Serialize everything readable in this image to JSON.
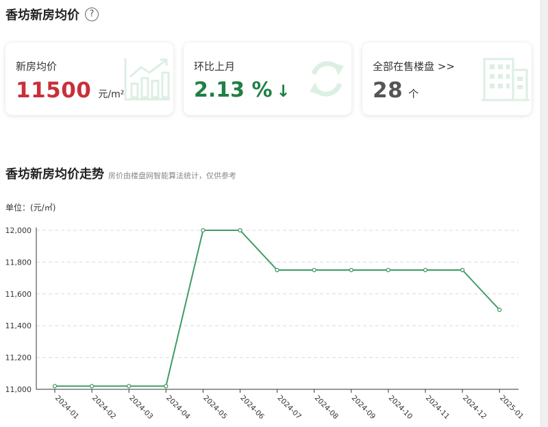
{
  "header": {
    "title": "香坊新房均价",
    "help_icon": "question-circle-icon"
  },
  "cards": {
    "price": {
      "label": "新房均价",
      "value": "11500",
      "unit": "元/m²",
      "value_color": "#c8303a",
      "icon": "trend-bars-icon"
    },
    "mom": {
      "label": "环比上月",
      "value": "2.13 %",
      "arrow": "↓",
      "value_color": "#1f7f45",
      "icon": "refresh-cycle-icon"
    },
    "listings": {
      "label": "全部在售楼盘 >>",
      "value": "28",
      "unit": "个",
      "value_color": "#555555",
      "icon": "building-icon"
    }
  },
  "section": {
    "title": "香坊新房均价走势",
    "note": "房价由楼盘网智能算法统计，仅供参考",
    "unit_label": "单位：(元/㎡)"
  },
  "colors": {
    "line": "#3f9a62",
    "grid": "#d9d9d9",
    "accent_red": "#c8303a",
    "accent_green": "#1f7f45",
    "deco_green": "#dcefe3"
  },
  "chart_data": {
    "type": "line",
    "categories": [
      "2024-01",
      "2024-02",
      "2024-03",
      "2024-04",
      "2024-05",
      "2024-06",
      "2024-07",
      "2024-08",
      "2024-09",
      "2024-10",
      "2024-11",
      "2024-12",
      "2025-01"
    ],
    "series": [
      {
        "values": [
          11020,
          11020,
          11020,
          11020,
          12000,
          12000,
          11750,
          11750,
          11750,
          11750,
          11750,
          11750,
          11500
        ]
      }
    ],
    "ylim": [
      11000,
      12000
    ],
    "yticks": [
      11000,
      11200,
      11400,
      11600,
      11800,
      12000
    ],
    "ytick_labels": [
      "11,000",
      "11,200",
      "11,400",
      "11,600",
      "11,800",
      "12,000"
    ],
    "grid": true,
    "xlabel": "",
    "ylabel": "单位：(元/㎡)"
  }
}
